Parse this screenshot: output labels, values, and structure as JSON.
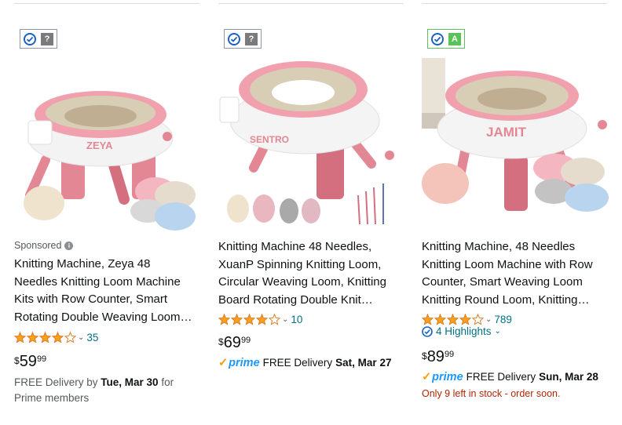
{
  "colors": {
    "link": "#007185",
    "star": "#f79f1f",
    "prime_blue": "#1a98ff",
    "stock_red": "#b12704"
  },
  "products": [
    {
      "badge_letter": "?",
      "sponsored": "Sponsored",
      "title_lines": [
        "Knitting Machine, Zeya 48",
        "Needles Knitting Loom Machine",
        "Kits with Row Counter, Smart",
        "Rotating Double Weaving Loom…"
      ],
      "brand_on_image": "ZEYA",
      "rating": 4.0,
      "rating_count": "35",
      "price": {
        "symbol": "$",
        "whole": "59",
        "fraction": "99"
      },
      "delivery_prefix": "FREE Delivery by ",
      "delivery_date": "Tue, Mar 30",
      "delivery_suffix": " for",
      "delivery_line2": "Prime members"
    },
    {
      "badge_letter": "?",
      "title_lines": [
        "Knitting Machine 48 Needles,",
        "XuanP Spinning Knitting Loom,",
        "Circular Weaving Loom, Knitting",
        "Board Rotating Double Knit…"
      ],
      "brand_on_image": "SENTRO",
      "rating": 4.0,
      "rating_count": "10",
      "price": {
        "symbol": "$",
        "whole": "69",
        "fraction": "99"
      },
      "prime_label": "prime",
      "delivery_prefix": "FREE Delivery",
      "delivery_date": "Sat, Mar 27"
    },
    {
      "badge_letter": "A",
      "title_lines": [
        "Knitting Machine, 48 Needles",
        "Knitting Loom Machine with Row",
        "Counter, Smart Weaving Loom",
        "Knitting Round Loom, Knitting…"
      ],
      "brand_on_image": "JAMIT",
      "rating": 4.0,
      "rating_count": "789",
      "highlights": "4 Highlights",
      "price": {
        "symbol": "$",
        "whole": "89",
        "fraction": "99"
      },
      "prime_label": "prime",
      "delivery_prefix": "FREE Delivery",
      "delivery_date": "Sun, Mar 28",
      "stock": "Only 9 left in stock - order soon."
    }
  ]
}
